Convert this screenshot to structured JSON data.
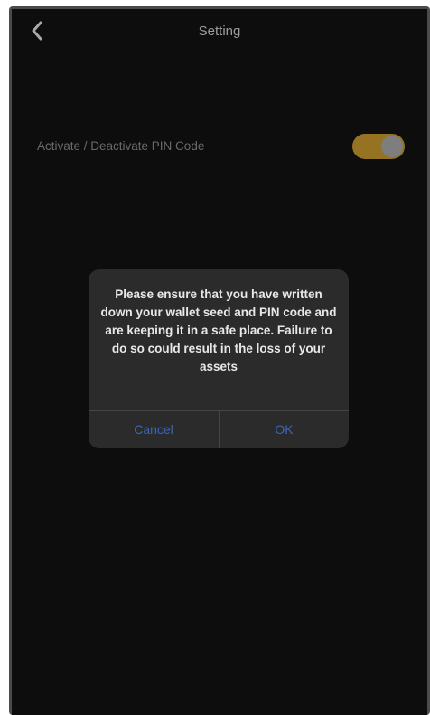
{
  "header": {
    "title": "Setting",
    "back_icon": "chevron-left-icon"
  },
  "settings": {
    "pin_label": "Activate / Deactivate PIN Code",
    "pin_enabled": true
  },
  "dialog": {
    "message": "Please ensure that you have written down your wallet seed and PIN code and are keeping it in a safe place. Failure to do so could result in the loss of your assets",
    "cancel_label": "Cancel",
    "ok_label": "OK"
  },
  "colors": {
    "background": "#121212",
    "toggle_on": "#c99a2e",
    "dialog_button": "#3a66b8"
  }
}
